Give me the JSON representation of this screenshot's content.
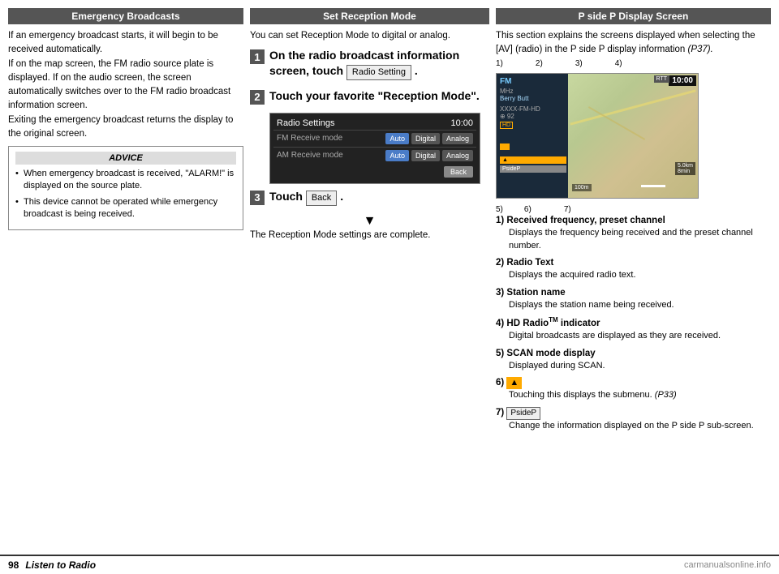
{
  "left": {
    "header": "Emergency Broadcasts",
    "body": "If an emergency broadcast starts, it will begin to be received automatically.\nIf on the map screen, the FM radio source plate is displayed. If on the audio screen, the screen automatically switches over to the FM radio broadcast information screen.\nExiting the emergency broadcast returns the display to the original screen.",
    "advice_header": "ADVICE",
    "advice_items": [
      "When emergency broadcast is received, \"ALARM!\" is displayed on the source plate.",
      "This device cannot be operated while emergency broadcast is being received."
    ]
  },
  "middle": {
    "header": "Set Reception Mode",
    "intro": "You can set Reception Mode to digital or analog.",
    "steps": [
      {
        "num": "1",
        "text": "On the radio broadcast information screen, touch",
        "button": "Radio Setting",
        "suffix": "."
      },
      {
        "num": "2",
        "text": "Touch your favorite “Reception Mode”.",
        "button": null,
        "suffix": null
      },
      {
        "num": "3",
        "text": "Touch",
        "button": "Back",
        "suffix": "."
      }
    ],
    "radio_settings": {
      "title": "Radio Settings",
      "time": "10:00",
      "rows": [
        {
          "label": "FM Receive mode",
          "buttons": [
            "Auto",
            "Digital",
            "Analog"
          ],
          "active": "Auto"
        },
        {
          "label": "AM Receive mode",
          "buttons": [
            "Auto",
            "Digital",
            "Analog"
          ],
          "active": "Auto"
        }
      ],
      "back_btn": "Back"
    },
    "arrow": "▼",
    "complete_text": "The Reception Mode settings are complete."
  },
  "right": {
    "header": "P side P Display Screen",
    "intro": "This section explains the screens displayed when selecting the [AV] (radio) in the P side P display information",
    "intro_ref": "(P37).",
    "screenshot": {
      "time": "10:00",
      "freq": "MHz",
      "band": "XXXX-FM-HD",
      "preset": "92",
      "hd_label": "HD",
      "town": "Berry Butt",
      "rtt": "RTT",
      "dist": "5.0km\n8min",
      "dist2": "100m"
    },
    "label_top": [
      "1)",
      "2)",
      "3)",
      "4)"
    ],
    "label_bottom": [
      "5)",
      "6)",
      "7)"
    ],
    "items": [
      {
        "num": "1)",
        "title": "Received frequency, preset channel",
        "desc": "Displays the frequency being received and the preset channel number."
      },
      {
        "num": "2)",
        "title": "Radio Text",
        "desc": "Displays the acquired radio text."
      },
      {
        "num": "3)",
        "title": "Station name",
        "desc": "Displays the station name being received."
      },
      {
        "num": "4)",
        "title": "HD Radio™ indicator",
        "desc": "Digital broadcasts are displayed as they are received."
      },
      {
        "num": "5)",
        "title": "SCAN mode display",
        "desc": "Displayed during SCAN."
      },
      {
        "num": "6)",
        "title": "▲",
        "desc": "Touching this displays the submenu. (P33)"
      },
      {
        "num": "7)",
        "title": "PsideP",
        "desc": "Change the information displayed on the P side P sub-screen."
      }
    ]
  },
  "footer": {
    "page_num": "98",
    "title": "Listen to Radio",
    "watermark": "carmanualsonline.info"
  }
}
